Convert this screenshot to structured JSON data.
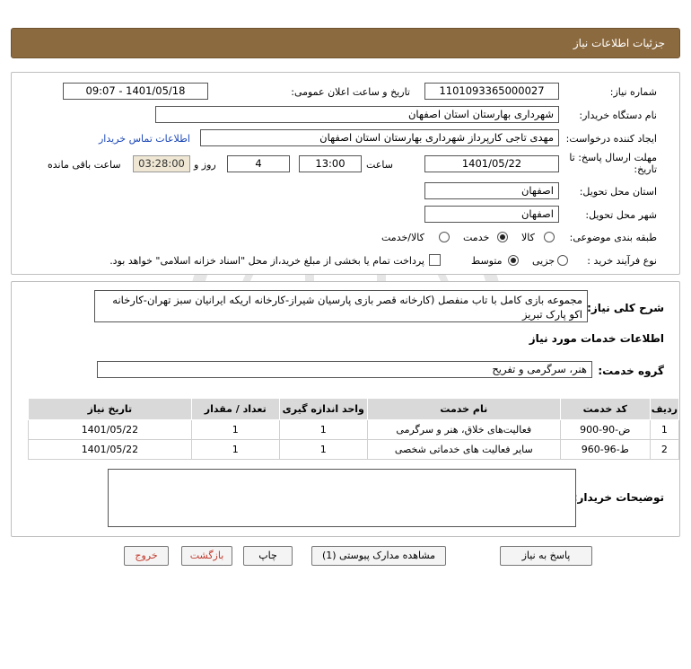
{
  "header": {
    "title": "جزئیات اطلاعات نیاز"
  },
  "form": {
    "need_number_label": "شماره نیاز:",
    "need_number": "1101093365000027",
    "announce_label": "تاریخ و ساعت اعلان عمومی:",
    "announce_value": "1401/05/18 - 09:07",
    "buyer_org_label": "نام دستگاه خریدار:",
    "buyer_org": "شهرداری بهارستان استان اصفهان",
    "creator_label": "ایجاد کننده درخواست:",
    "creator": "مهدی تاجی کارپرداز شهرداری بهارستان استان اصفهان",
    "contact_link": "اطلاعات تماس خریدار",
    "deadline_label_1": "مهلت ارسال پاسخ: تا",
    "deadline_label_2": "تاریخ:",
    "deadline_date": "1401/05/22",
    "time_label": "ساعت",
    "deadline_time": "13:00",
    "days_value": "4",
    "days_label": "روز و",
    "remaining_time": "03:28:00",
    "remaining_label": "ساعت باقی مانده",
    "province_label": "استان محل تحویل:",
    "province": "اصفهان",
    "city_label": "شهر محل تحویل:",
    "city": "اصفهان",
    "category_label": "طبقه بندی موضوعی:",
    "category_options": [
      "کالا",
      "خدمت",
      "کالا/خدمت"
    ],
    "category_selected": "خدمت",
    "process_label": "نوع فرآیند خرید :",
    "process_options": [
      "جزیی",
      "متوسط"
    ],
    "process_selected": "متوسط",
    "payment_note": "پرداخت تمام یا بخشی از مبلغ خرید،از محل \"اسناد خزانه اسلامی\" خواهد بود."
  },
  "details": {
    "summary_label": "شرح کلی نیاز:",
    "summary": "مجموعه بازی کامل با تاب منفصل (کارخانه قصر بازی پارسیان شیراز-کارخانه اریکه ایرانیان سبز تهران-کارخانه اکو پارک تبریز",
    "services_title": "اطلاعات خدمات مورد نیاز",
    "service_group_label": "گروه خدمت:",
    "service_group": "هنر، سرگرمی و تفریح",
    "table": {
      "headers": [
        "ردیف",
        "کد خدمت",
        "نام خدمت",
        "واحد اندازه گیری",
        "تعداد / مقدار",
        "تاریخ نیاز"
      ],
      "rows": [
        [
          "1",
          "ض-90-900",
          "فعالیت‌های خلاق، هنر و سرگرمی",
          "1",
          "1",
          "1401/05/22"
        ],
        [
          "2",
          "ط-96-960",
          "سایر فعالیت های خدماتی شخصی",
          "1",
          "1",
          "1401/05/22"
        ]
      ]
    },
    "buyer_notes_label": "توضیحات خریدار:",
    "buyer_notes": ""
  },
  "buttons": {
    "reply": "پاسخ به نیاز",
    "attachments": "مشاهده مدارک پیوستی (1)",
    "print": "چاپ",
    "back": "بازگشت",
    "exit": "خروج"
  },
  "colors": {
    "header_bg": "#8c6a3f",
    "back_text": "#c0392b",
    "exit_text": "#c0392b",
    "link": "#1a47b8"
  }
}
